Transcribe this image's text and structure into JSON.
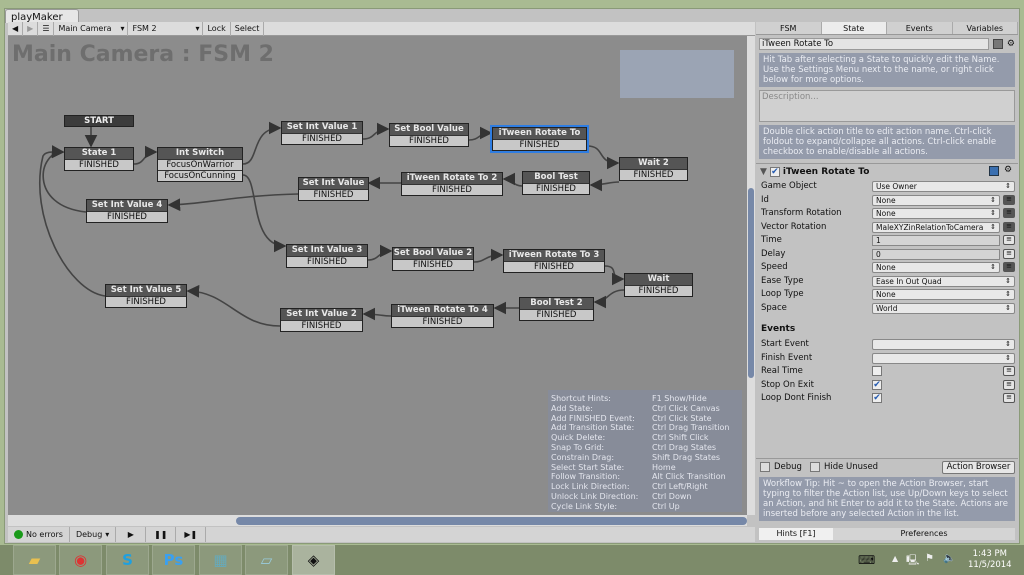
{
  "window": {
    "tab_title": "playMaker"
  },
  "toolbar": {
    "back": "◀",
    "forward": "▶",
    "menu": "☰",
    "object": "Main Camera",
    "fsm": "FSM 2",
    "lock": "Lock",
    "select": "Select"
  },
  "graph": {
    "title": "Main Camera : FSM 2",
    "start_label": "START",
    "states": [
      {
        "name": "State 1",
        "events": [
          "FINISHED"
        ]
      },
      {
        "name": "Int Switch",
        "events": [
          "FocusOnWarrior",
          "FocusOnCunning"
        ]
      },
      {
        "name": "Set Int Value 1",
        "events": [
          "FINISHED"
        ]
      },
      {
        "name": "Set Bool Value",
        "events": [
          "FINISHED"
        ]
      },
      {
        "name": "iTween Rotate To",
        "events": [
          "FINISHED"
        ],
        "selected": true
      },
      {
        "name": "Wait 2",
        "events": [
          "FINISHED"
        ]
      },
      {
        "name": "Bool Test",
        "events": [
          "FINISHED"
        ]
      },
      {
        "name": "iTween Rotate To 2",
        "events": [
          "FINISHED"
        ]
      },
      {
        "name": "Set Int Value",
        "events": [
          "FINISHED"
        ]
      },
      {
        "name": "Set Int Value 4",
        "events": [
          "FINISHED"
        ]
      },
      {
        "name": "Set Int Value 3",
        "events": [
          "FINISHED"
        ]
      },
      {
        "name": "Set Bool Value 2",
        "events": [
          "FINISHED"
        ]
      },
      {
        "name": "iTween Rotate To 3",
        "events": [
          "FINISHED"
        ]
      },
      {
        "name": "Wait",
        "events": [
          "FINISHED"
        ]
      },
      {
        "name": "Bool Test 2",
        "events": [
          "FINISHED"
        ]
      },
      {
        "name": "iTween Rotate To 4",
        "events": [
          "FINISHED"
        ]
      },
      {
        "name": "Set Int Value 2",
        "events": [
          "FINISHED"
        ]
      },
      {
        "name": "Set Int Value 5",
        "events": [
          "FINISHED"
        ]
      }
    ]
  },
  "hints": [
    [
      "Shortcut Hints:",
      "F1 Show/Hide"
    ],
    [
      "Add State:",
      "Ctrl Click Canvas"
    ],
    [
      "Add FINISHED Event:",
      "Ctrl Click State"
    ],
    [
      "Add Transition State:",
      "Ctrl Drag Transition"
    ],
    [
      "Quick Delete:",
      "Ctrl Shift Click"
    ],
    [
      "Snap To Grid:",
      "Ctrl Drag States"
    ],
    [
      "Constrain Drag:",
      "Shift Drag States"
    ],
    [
      "Select Start State:",
      "Home"
    ],
    [
      "Follow Transition:",
      "Alt Click Transition"
    ],
    [
      "Lock Link Direction:",
      "Ctrl Left/Right"
    ],
    [
      "Unlock Link Direction:",
      "Ctrl Down"
    ],
    [
      "Cycle Link Style:",
      "Ctrl Up"
    ]
  ],
  "status": {
    "errors": "No errors",
    "debug": "Debug",
    "play": "▶",
    "pause": "❚❚",
    "step": "▶❚"
  },
  "inspector": {
    "tabs": [
      "FSM",
      "State",
      "Events",
      "Variables"
    ],
    "active_tab": "State",
    "state_name": "iTween Rotate To",
    "name_hint": "Hit Tab after selecting a State to quickly edit the Name. Use the Settings Menu next to the name, or right click below for more options.",
    "description_placeholder": "Description...",
    "action_hint": "Double click action title to edit action name. Ctrl-click foldout to expand/collapse all actions. Ctrl-click enable checkbox to enable/disable all actions.",
    "action_title": "iTween Rotate To",
    "props": [
      {
        "label": "Game Object",
        "value": "Use Owner",
        "type": "dropdown"
      },
      {
        "label": "Id",
        "value": "None",
        "type": "dropdown",
        "var": "dark"
      },
      {
        "label": "Transform Rotation",
        "value": "None",
        "type": "dropdown",
        "var": "dark"
      },
      {
        "label": "Vector Rotation",
        "value": "MaleXYZinRelationToCamera",
        "type": "dropdown",
        "var": "dark"
      },
      {
        "label": "Time",
        "value": "1",
        "type": "text",
        "var": "light"
      },
      {
        "label": "Delay",
        "value": "0",
        "type": "text",
        "var": "light"
      },
      {
        "label": "Speed",
        "value": "None",
        "type": "dropdown",
        "var": "dark"
      },
      {
        "label": "Ease Type",
        "value": "Ease In Out Quad",
        "type": "dropdown"
      },
      {
        "label": "Loop Type",
        "value": "None",
        "type": "dropdown"
      },
      {
        "label": "Space",
        "value": "World",
        "type": "dropdown"
      }
    ],
    "events_heading": "Events",
    "events": [
      {
        "label": "Start Event",
        "value": "",
        "type": "dropdown"
      },
      {
        "label": "Finish Event",
        "value": "",
        "type": "dropdown"
      },
      {
        "label": "Real Time",
        "checked": false,
        "type": "check"
      },
      {
        "label": "Stop On Exit",
        "checked": true,
        "type": "check"
      },
      {
        "label": "Loop Dont Finish",
        "checked": true,
        "type": "check"
      }
    ],
    "debug_label": "Debug",
    "hide_unused_label": "Hide Unused",
    "action_browser": "Action Browser",
    "workflow_tip": "Workflow Tip: Hit ~ to open the Action Browser, start typing to filter the Action list, use Up/Down keys to select an Action, and hit Enter to add it to the State. Actions are inserted before any selected Action in the list.",
    "bottom_tabs": [
      "Hints [F1]",
      "Preferences"
    ]
  },
  "taskbar": {
    "apps": [
      "file-explorer",
      "chrome",
      "skype",
      "photoshop",
      "calculator",
      "notepad",
      "unity"
    ],
    "time": "1:43 PM",
    "date": "11/5/2014"
  },
  "colors": {
    "selection": "#2f7de1",
    "graph_bg": "#8c8c8c",
    "hint_box": "#949bab"
  }
}
